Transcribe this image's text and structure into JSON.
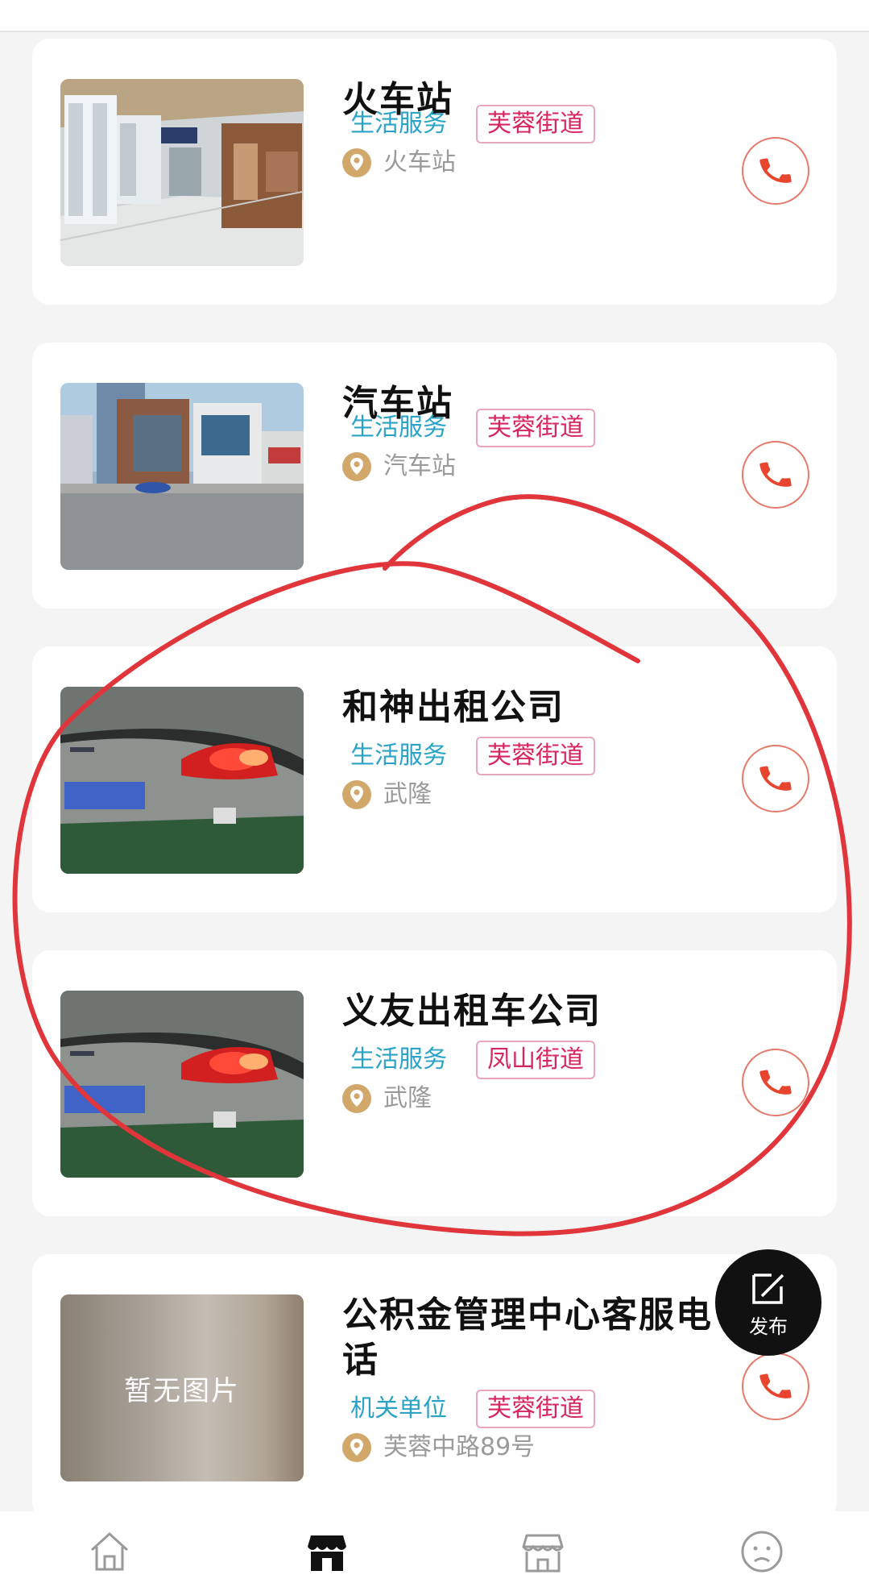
{
  "listings": [
    {
      "title_lines": [
        "火车站"
      ],
      "category": "生活服务",
      "area": "芙蓉街道",
      "address": "火车站",
      "image": "station-hall-photo"
    },
    {
      "title_lines": [
        "汽车站"
      ],
      "category": "生活服务",
      "area": "芙蓉街道",
      "address": "汽车站",
      "image": "bus-station-photo"
    },
    {
      "title_lines": [
        "和神出租公司"
      ],
      "category": "生活服务",
      "area": "芙蓉街道",
      "address": "武隆",
      "image": "taxi-photo"
    },
    {
      "title_lines": [
        "义友出租车公司"
      ],
      "category": "生活服务",
      "area": "凤山街道",
      "address": "武隆",
      "image": "taxi-photo"
    },
    {
      "title_lines": [
        "公积金管理中心客服电",
        "话"
      ],
      "category": "机关单位",
      "area": "芙蓉街道",
      "address": "芙蓉中路89号",
      "image": "no-image-placeholder",
      "no_image_text": "暂无图片"
    }
  ],
  "fab": {
    "label": "发布",
    "icon": "edit-icon"
  },
  "bottom_nav": [
    {
      "icon": "home-icon",
      "active": false
    },
    {
      "icon": "shop-icon",
      "active": true
    },
    {
      "icon": "store-icon",
      "active": false
    },
    {
      "icon": "face-icon",
      "active": false
    }
  ],
  "colors": {
    "category": "#2aa3c7",
    "area": "#d6265e",
    "call": "#e8452e",
    "annotation": "#e0363b",
    "pin": "#d2a76a"
  }
}
